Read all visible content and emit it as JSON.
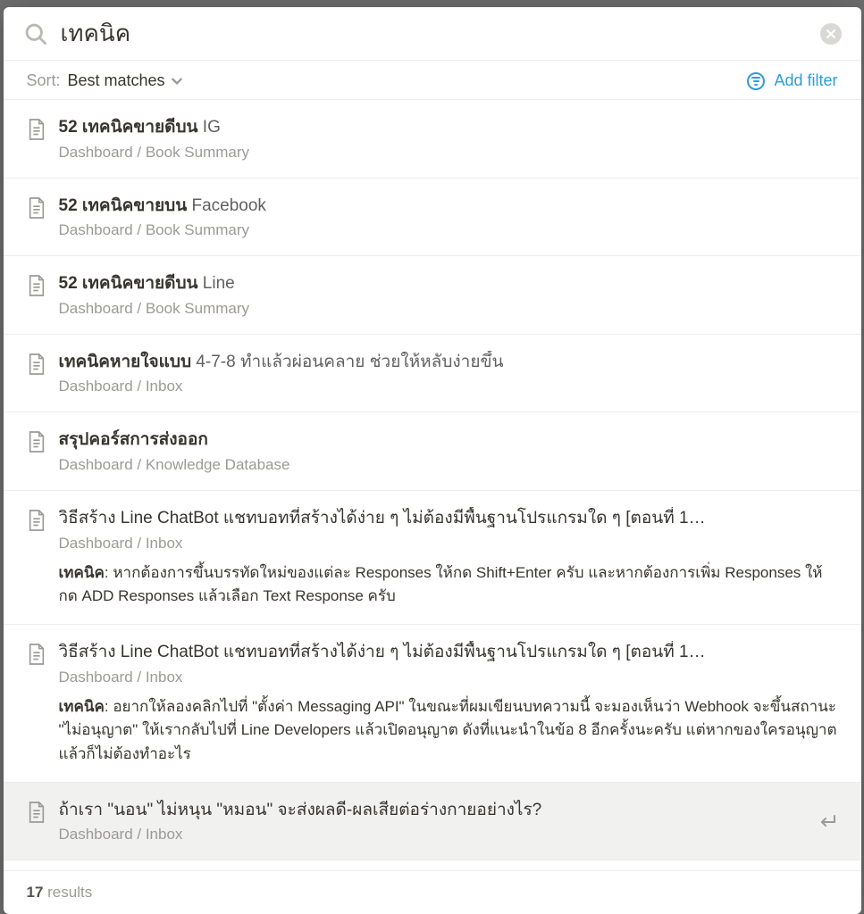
{
  "search": {
    "query": "เทคนิค",
    "placeholder": ""
  },
  "controls": {
    "sort_label": "Sort:",
    "sort_value": "Best matches",
    "add_filter": "Add filter"
  },
  "results": [
    {
      "title_prefix": "52 เทคนิคขายดีบน",
      "title_rest": " IG",
      "path": "Dashboard / Book Summary",
      "snippet": ""
    },
    {
      "title_prefix": "52 เทคนิคขายบน",
      "title_rest": " Facebook",
      "path": "Dashboard / Book Summary",
      "snippet": ""
    },
    {
      "title_prefix": "52 เทคนิคขายดีบน",
      "title_rest": " Line",
      "path": "Dashboard / Book Summary",
      "snippet": ""
    },
    {
      "title_prefix": "เทคนิคหายใจแบบ",
      "title_rest": " 4-7-8 ทำแล้วผ่อนคลาย ช่วยให้หลับง่ายขึ้น",
      "path": "Dashboard / Inbox",
      "snippet": ""
    },
    {
      "title_prefix": "สรุปคอร์สการส่งออก",
      "title_rest": "",
      "path": "Dashboard / Knowledge Database",
      "snippet": ""
    },
    {
      "title_prefix": "",
      "title_rest": "วิธีสร้าง Line ChatBot แชทบอทที่สร้างได้ง่าย ๆ ไม่ต้องมีพื้นฐานโปรแกรมใด ๆ [ตอนที่ 1…",
      "path": "Dashboard / Inbox",
      "snippet_bold": "เทคนิค",
      "snippet_rest": ": หากต้องการขึ้นบรรทัดใหม่ของแต่ละ Responses ให้กด Shift+Enter ครับ และหากต้องการเพิ่ม Responses ให้กด ADD Responses แล้วเลือก Text Response ครับ"
    },
    {
      "title_prefix": "",
      "title_rest": "วิธีสร้าง Line ChatBot แชทบอทที่สร้างได้ง่าย ๆ ไม่ต้องมีพื้นฐานโปรแกรมใด ๆ [ตอนที่ 1…",
      "path": "Dashboard / Inbox",
      "snippet_bold": "เทคนิค",
      "snippet_rest": ": อยากให้ลองคลิกไปที่ \"ตั้งค่า Messaging API\" ในขณะที่ผมเขียนบทความนี้ จะมองเห็นว่า Webhook จะขึ้นสถานะ \"ไม่อนุญาต\" ให้เรากลับไปที่ Line Developers แล้วเปิดอนุญาต ดังที่แนะนำในข้อ 8 อีกครั้งนะครับ แต่หากของใครอนุญาตแล้วก็ไม่ต้องทำอะไร"
    },
    {
      "title_prefix": "",
      "title_rest": "ถ้าเรา \"นอน\" ไม่หนุน \"หมอน\" จะส่งผลดี-ผลเสียต่อร่างกายอย่างไร?",
      "path": "Dashboard / Inbox",
      "snippet": "",
      "active": true
    }
  ],
  "footer": {
    "count": "17",
    "label": " results"
  }
}
